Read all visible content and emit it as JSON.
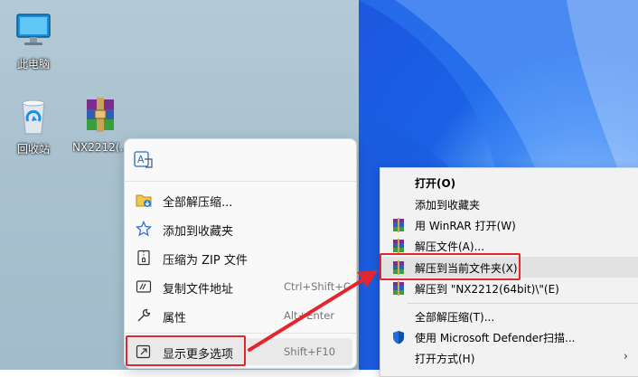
{
  "desktop": {
    "icons": [
      {
        "label": "此电脑",
        "icon": "computer-icon"
      },
      {
        "label": "回收站",
        "icon": "recycle-bin-icon"
      },
      {
        "label": "NX2212(…",
        "icon": "winrar-archive-icon"
      }
    ]
  },
  "context_menu": {
    "top_icon": "translate-icon",
    "items": [
      {
        "label": "全部解压缩...",
        "shortcut": "",
        "icon": "extract-all-icon"
      },
      {
        "label": "添加到收藏夹",
        "shortcut": "",
        "icon": "star-icon"
      },
      {
        "label": "压缩为 ZIP 文件",
        "shortcut": "",
        "icon": "zip-icon"
      },
      {
        "label": "复制文件地址",
        "shortcut": "Ctrl+Shift+C",
        "icon": "copy-path-icon"
      },
      {
        "label": "属性",
        "shortcut": "Alt+Enter",
        "icon": "wrench-icon"
      },
      {
        "label": "显示更多选项",
        "shortcut": "Shift+F10",
        "icon": "show-more-icon"
      }
    ]
  },
  "classic_menu": {
    "items": [
      {
        "label": "打开(O)",
        "icon": "",
        "bold": true
      },
      {
        "label": "添加到收藏夹",
        "icon": ""
      },
      {
        "label": "用 WinRAR 打开(W)",
        "icon": "winrar-icon"
      },
      {
        "label": "解压文件(A)...",
        "icon": "winrar-icon"
      },
      {
        "label": "解压到当前文件夹(X)",
        "icon": "winrar-icon"
      },
      {
        "label": "解压到 \"NX2212(64bit)\\\"(E)",
        "icon": "winrar-icon"
      },
      {
        "label": "全部解压缩(T)...",
        "icon": ""
      },
      {
        "label": "使用 Microsoft Defender扫描...",
        "icon": "defender-shield-icon"
      },
      {
        "label": "打开方式(H)",
        "icon": "",
        "submenu": true
      }
    ]
  },
  "colors": {
    "highlight_box": "#e3262d",
    "arrow": "#e3262d"
  }
}
